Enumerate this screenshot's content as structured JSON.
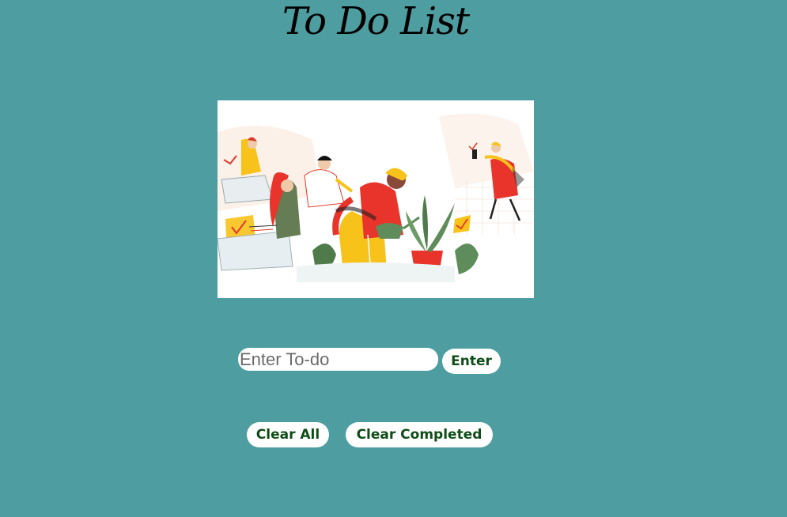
{
  "page": {
    "title": "To Do List",
    "background_color": "#4e9ea1"
  },
  "illustration": {
    "description_icon": "people-doing-tasks-illustration"
  },
  "todo_form": {
    "input_placeholder": "Enter To-do",
    "input_value": "",
    "enter_label": "Enter"
  },
  "actions": {
    "clear_all_label": "Clear All",
    "clear_completed_label": "Clear Completed"
  },
  "colors": {
    "button_text": "#0e4d17",
    "button_bg": "#ffffff"
  }
}
